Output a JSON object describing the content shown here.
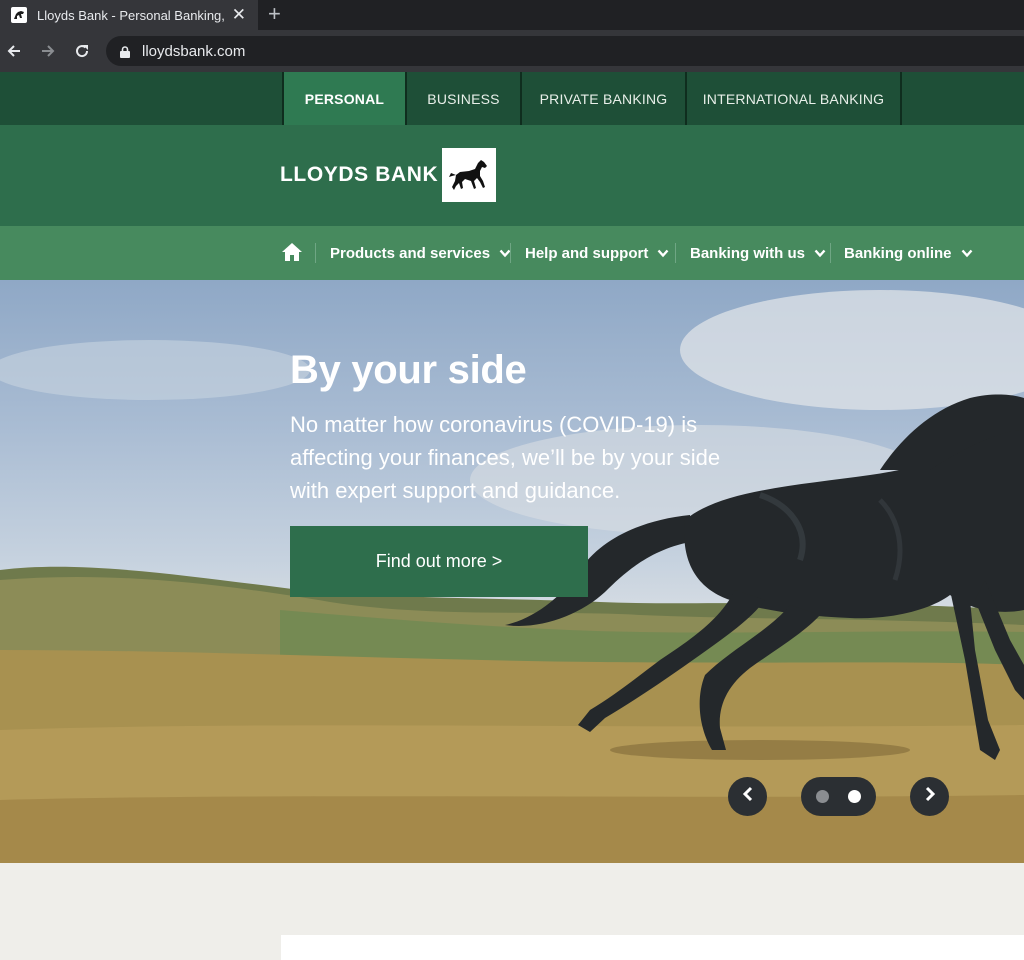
{
  "browser": {
    "tab_title": "Lloyds Bank - Personal Banking, P",
    "url": "lloydsbank.com",
    "icons": [
      "back-arrow-icon",
      "forward-arrow-icon",
      "reload-icon",
      "lock-icon",
      "close-icon",
      "plus-icon"
    ]
  },
  "topnav": {
    "items": [
      {
        "label": "PERSONAL",
        "active": true
      },
      {
        "label": "BUSINESS"
      },
      {
        "label": "PRIVATE BANKING"
      },
      {
        "label": "INTERNATIONAL BANKING"
      }
    ]
  },
  "brand": {
    "name": "LLOYDS BANK",
    "logo_icon": "black-horse-icon"
  },
  "mainnav": {
    "items": [
      {
        "label": "Products and services"
      },
      {
        "label": "Help and support"
      },
      {
        "label": "Banking with us"
      },
      {
        "label": "Banking online"
      }
    ]
  },
  "hero": {
    "title": "By your side",
    "text": "No matter how coronavirus (COVID-19) is affecting your finances, we’ll be by your side with expert support and guidance.",
    "cta": "Find out more >",
    "carousel": {
      "slides": 2,
      "active_index": 1
    }
  },
  "colors": {
    "brand_green": "#2e6e4c",
    "dark_green": "#1e4f37",
    "nav_green": "#478a5e",
    "control_dark": "#2b2f33"
  }
}
